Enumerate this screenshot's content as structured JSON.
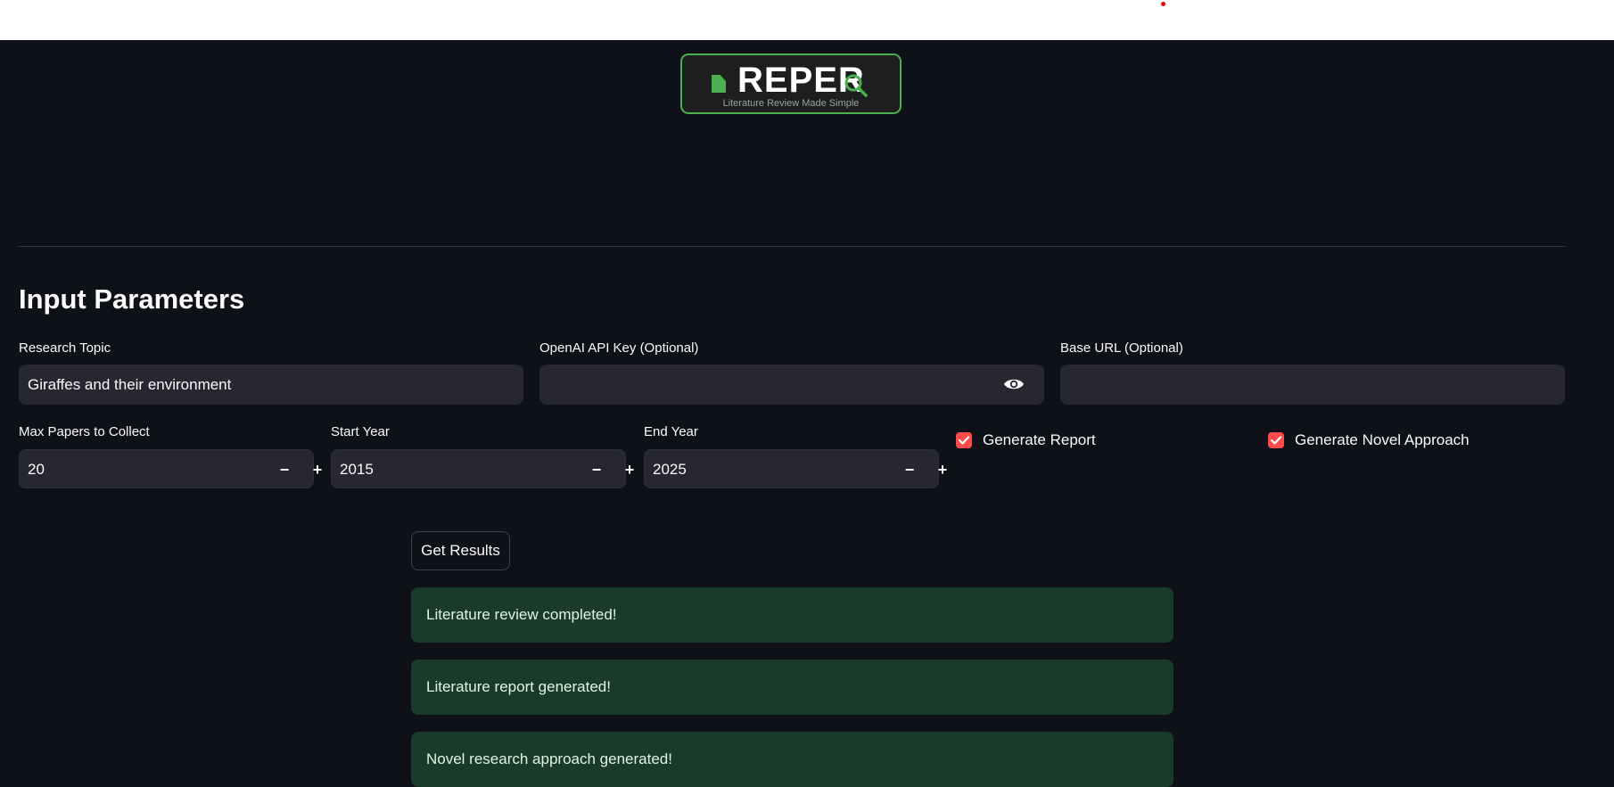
{
  "header": {
    "logo_word": "REPER",
    "logo_tagline": "Literature Review Made Simple",
    "icons": [
      "document-icon",
      "magnifier-icon"
    ]
  },
  "section_title": "Input Parameters",
  "fields": {
    "research_topic": {
      "label": "Research Topic",
      "value": "Giraffes and their environment"
    },
    "api_key": {
      "label": "OpenAI API Key (Optional)",
      "value": ""
    },
    "base_url": {
      "label": "Base URL (Optional)",
      "value": ""
    }
  },
  "numbers": {
    "max_papers": {
      "label": "Max Papers to Collect",
      "value": "20"
    },
    "start_year": {
      "label": "Start Year",
      "value": "2015"
    },
    "end_year": {
      "label": "End Year",
      "value": "2025"
    },
    "minus": "−",
    "plus": "+"
  },
  "checks": {
    "generate_report": {
      "label": "Generate Report",
      "checked": true
    },
    "generate_novel": {
      "label": "Generate Novel Approach",
      "checked": true
    }
  },
  "get_results_label": "Get Results",
  "alerts": [
    "Literature review completed!",
    "Literature report generated!",
    "Novel research approach generated!"
  ],
  "colors": {
    "background": "#0e1117",
    "input": "#262730",
    "accent_green": "#4caf50",
    "checkbox": "#ff4b4b",
    "success_bg": "#1a3b2a"
  }
}
